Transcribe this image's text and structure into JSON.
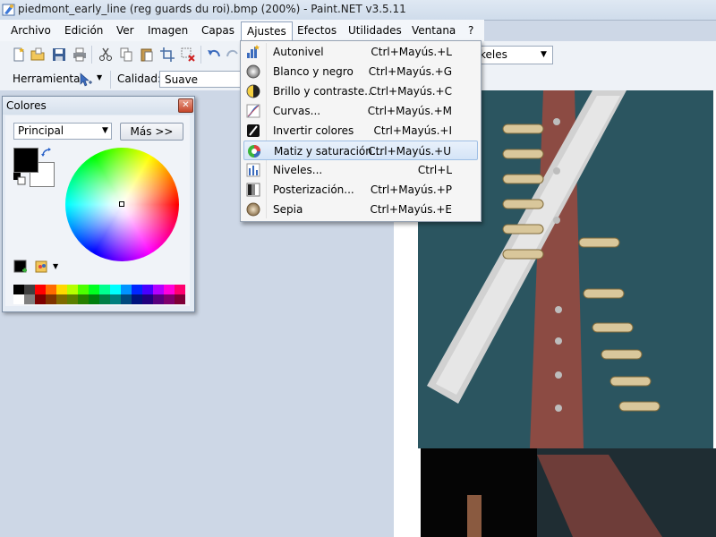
{
  "window": {
    "title": "piedmont_early_line (reg guards du roi).bmp (200%) - Paint.NET v3.5.11"
  },
  "menubar": {
    "items": [
      {
        "label": "Archivo"
      },
      {
        "label": "Edición"
      },
      {
        "label": "Ver"
      },
      {
        "label": "Imagen"
      },
      {
        "label": "Capas"
      },
      {
        "label": "Ajustes",
        "active": true
      },
      {
        "label": "Efectos"
      },
      {
        "label": "Utilidades"
      },
      {
        "label": "Ventana"
      },
      {
        "label": "?"
      }
    ]
  },
  "toolbar": {
    "tool_label": "Herramienta:",
    "quality_label": "Calidad:",
    "quality_value": "Suave",
    "units_value": "keles"
  },
  "colors_window": {
    "title": "Colores",
    "mode_value": "Principal",
    "more_button": "Más >>",
    "primary_color": "#000000",
    "secondary_color": "#ffffff",
    "palette": [
      "#000000",
      "#404040",
      "#ff0000",
      "#ff6a00",
      "#ffd800",
      "#b6ff00",
      "#4cff00",
      "#00ff21",
      "#00ff90",
      "#00ffff",
      "#0094ff",
      "#0026ff",
      "#4800ff",
      "#b200ff",
      "#ff00dc",
      "#ff006e",
      "#ffffff",
      "#808080",
      "#7f0000",
      "#7f3300",
      "#7f6a00",
      "#5b7f00",
      "#267f00",
      "#007f0e",
      "#007f46",
      "#007f7f",
      "#004a7f",
      "#00137f",
      "#21007f",
      "#57007f",
      "#7f006e",
      "#7f0037"
    ]
  },
  "ajustes_menu": {
    "items": [
      {
        "label": "Autonivel",
        "shortcut": "Ctrl+Mayús.+L",
        "icon": "auto-level-icon"
      },
      {
        "label": "Blanco y negro",
        "shortcut": "Ctrl+Mayús.+G",
        "icon": "black-white-icon"
      },
      {
        "label": "Brillo y contraste...",
        "shortcut": "Ctrl+Mayús.+C",
        "icon": "brightness-contrast-icon"
      },
      {
        "label": "Curvas...",
        "shortcut": "Ctrl+Mayús.+M",
        "icon": "curves-icon"
      },
      {
        "label": "Invertir colores",
        "shortcut": "Ctrl+Mayús.+I",
        "icon": "invert-colors-icon"
      },
      {
        "label": "Matiz y saturación...",
        "shortcut": "Ctrl+Mayús.+U",
        "icon": "hue-saturation-icon",
        "highlighted": true
      },
      {
        "label": "Niveles...",
        "shortcut": "Ctrl+L",
        "icon": "levels-icon"
      },
      {
        "label": "Posterización...",
        "shortcut": "Ctrl+Mayús.+P",
        "icon": "posterize-icon"
      },
      {
        "label": "Sepia",
        "shortcut": "Ctrl+Mayús.+E",
        "icon": "sepia-icon"
      }
    ]
  }
}
